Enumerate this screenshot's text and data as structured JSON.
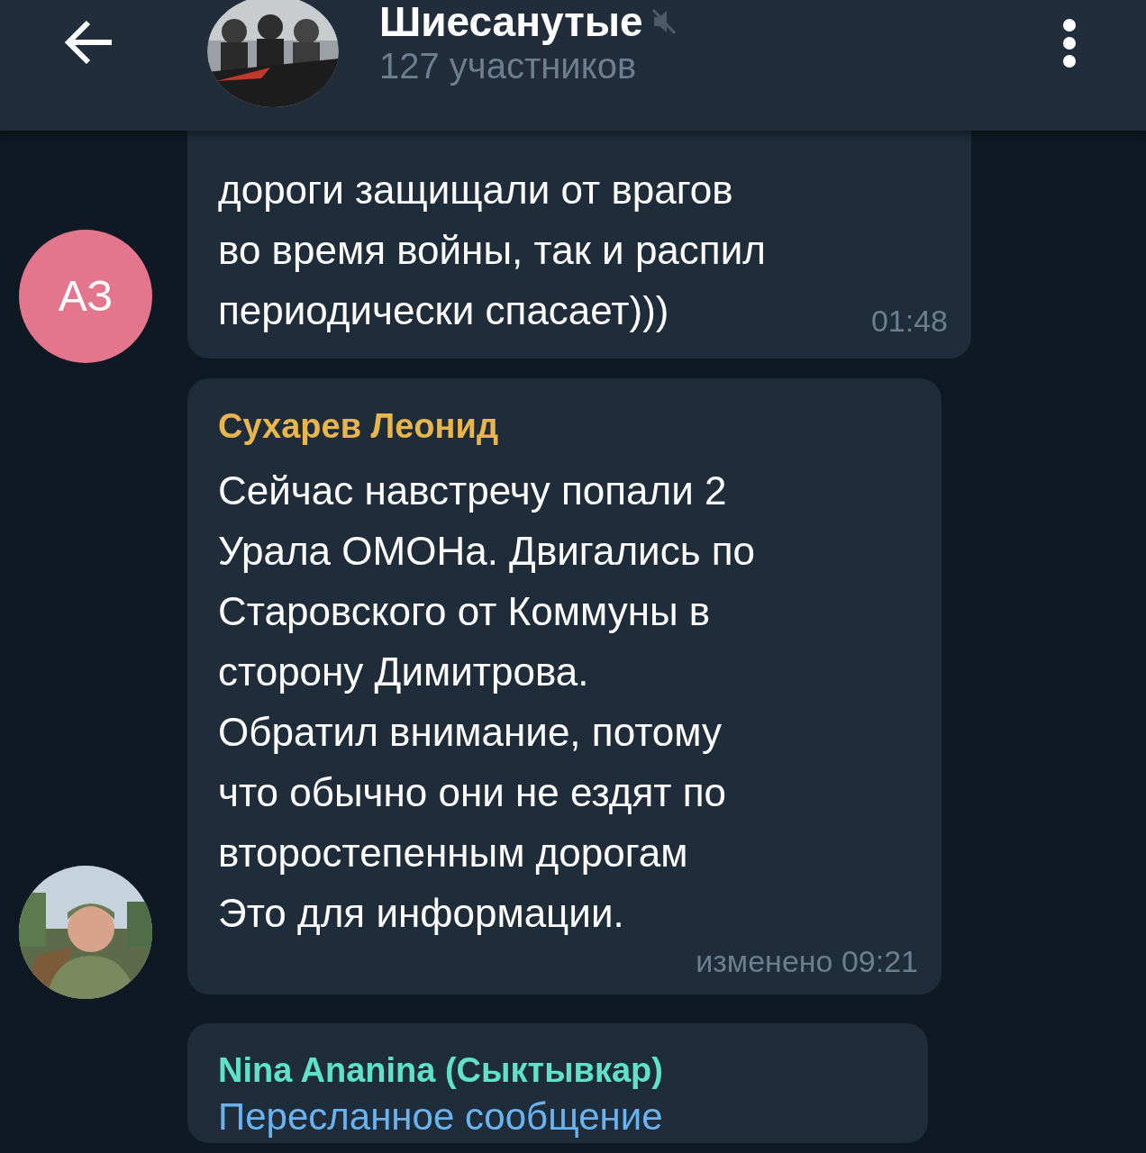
{
  "header": {
    "title": "Шиесанутые",
    "muted": true,
    "subtitle": "127 участников"
  },
  "messages": [
    {
      "avatar": {
        "kind": "initials",
        "text": "АЗ",
        "color": "#e3768c"
      },
      "lines": [
        "дороги защищали от врагов",
        "во время войны, так и распил",
        "периодически спасает)))"
      ],
      "time": "01:48"
    },
    {
      "sender": "Сухарев Леонид",
      "color": "#e9b64d",
      "lines": [
        "Сейчас навстречу попали 2",
        "Урала ОМОНа. Двигались по",
        "Старовского от Коммуны в",
        "сторону Димитрова.",
        "Обратил внимание, потому",
        "что обычно они не ездят по",
        "второстепенным дорогам",
        "Это для информации."
      ],
      "time": "изменено 09:21"
    },
    {
      "sender": "Nina Ananina (Сыктывкар)",
      "color": "#5fe2c9",
      "forwarded": "Пересланное сообщение"
    }
  ]
}
